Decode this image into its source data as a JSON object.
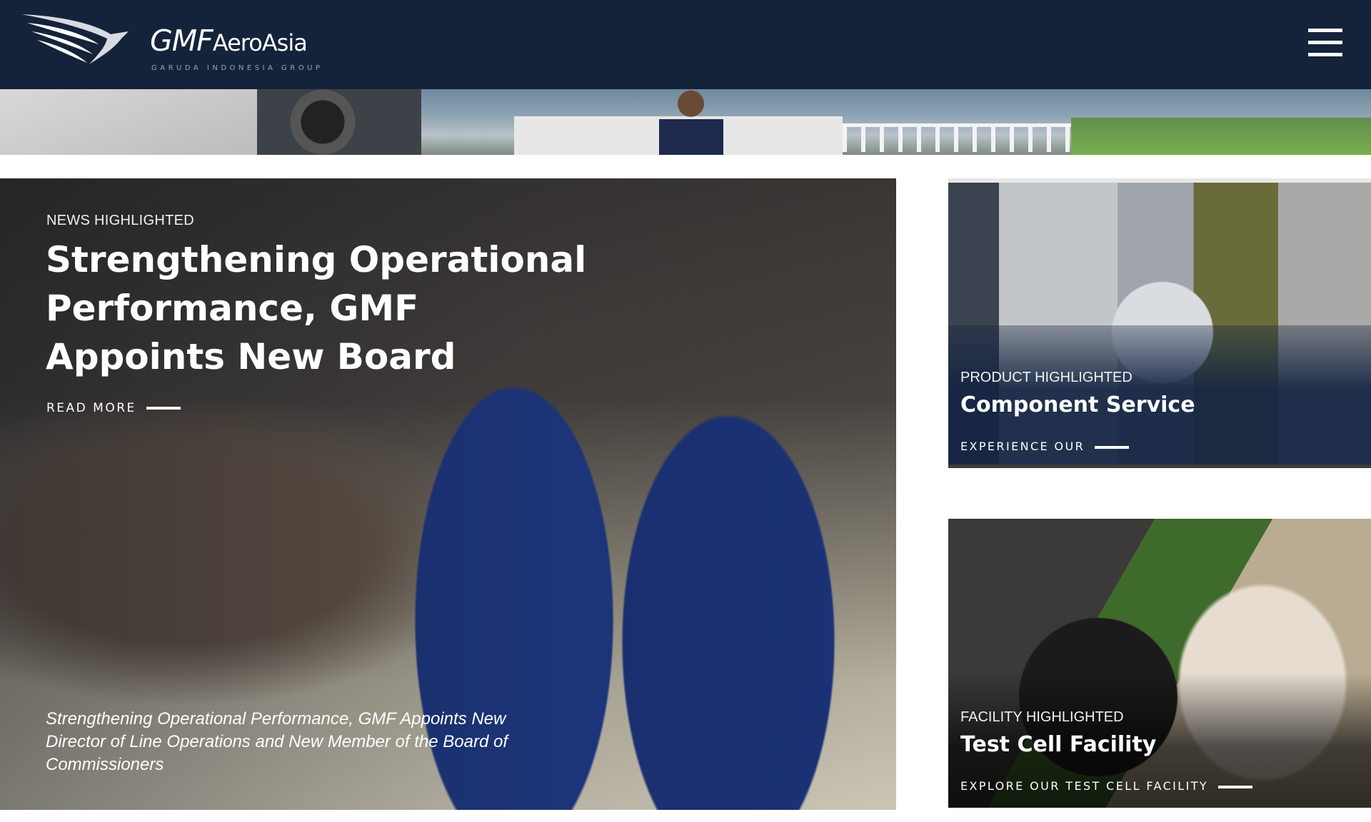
{
  "header": {
    "logo_main": "GMF",
    "logo_secondary": "AeroAsia",
    "logo_tagline": "GARUDA INDONESIA GROUP",
    "menu_icon": "hamburger-menu-icon"
  },
  "news": {
    "eyebrow": "NEWS HIGHLIGHTED",
    "headline": "Strengthening Operational Performance, GMF Appoints New Board",
    "read_more": "READ MORE",
    "caption": "Strengthening Operational Performance, GMF Appoints New Director of Line Operations and New Member of the Board of Commissioners"
  },
  "product": {
    "eyebrow": "PRODUCT HIGHLIGHTED",
    "title": "Component Service",
    "cta": "EXPERIENCE OUR"
  },
  "facility": {
    "eyebrow": "FACILITY HIGHLIGHTED",
    "title": "Test Cell Facility",
    "cta": "EXPLORE OUR TEST CELL FACILITY"
  },
  "colors": {
    "header_bg": "#15233a",
    "card_overlay": "#132442",
    "text": "#ffffff"
  }
}
